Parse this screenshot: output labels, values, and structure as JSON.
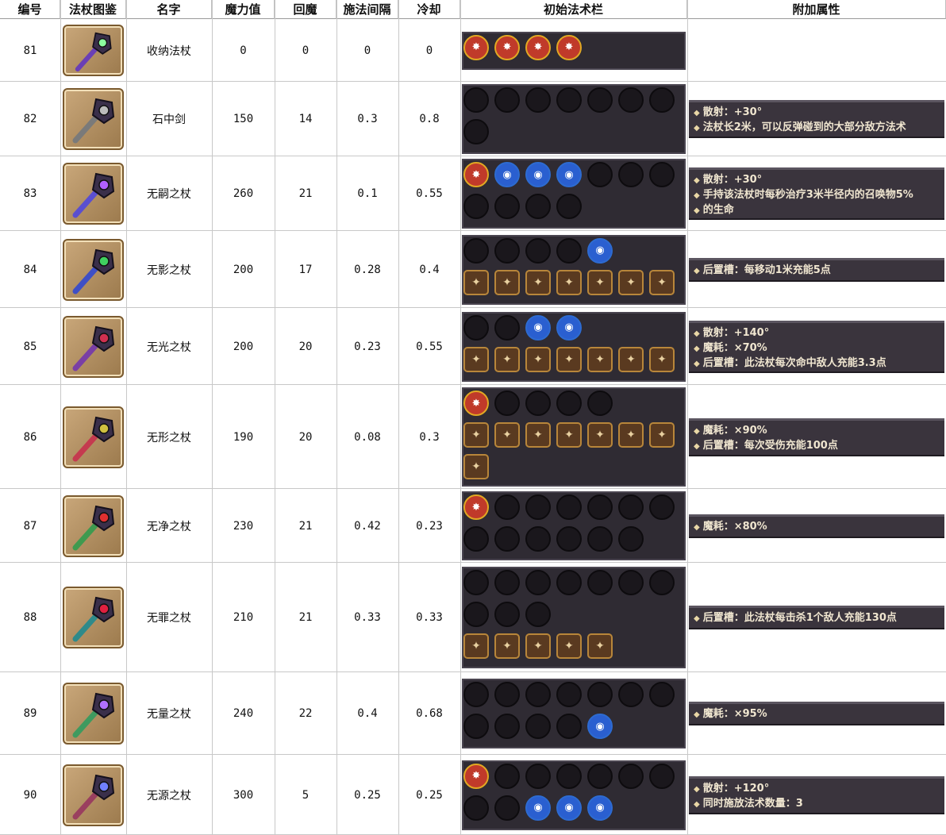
{
  "headers": {
    "id": "编号",
    "icon": "法杖图鉴",
    "name": "名字",
    "mana": "魔力值",
    "regen": "回魔",
    "interval": "施法间隔",
    "cooldown": "冷却",
    "spells": "初始法术栏",
    "attrs": "附加属性"
  },
  "rows": [
    {
      "id": "81",
      "name": "收纳法杖",
      "mana": "0",
      "regen": "0",
      "interval": "0",
      "cooldown": "0",
      "attrs": []
    },
    {
      "id": "82",
      "name": "石中剑",
      "mana": "150",
      "regen": "14",
      "interval": "0.3",
      "cooldown": "0.8",
      "attrs": [
        "散射：+30°",
        "法杖长2米，可以反弹碰到的大部分敌方法术"
      ]
    },
    {
      "id": "83",
      "name": "无嗣之杖",
      "mana": "260",
      "regen": "21",
      "interval": "0.1",
      "cooldown": "0.55",
      "attrs": [
        "散射：+30°",
        "手持该法杖时每秒治疗3米半径内的召唤物5%",
        "的生命"
      ]
    },
    {
      "id": "84",
      "name": "无影之杖",
      "mana": "200",
      "regen": "17",
      "interval": "0.28",
      "cooldown": "0.4",
      "attrs": [
        "后置槽：每移动1米充能5点"
      ]
    },
    {
      "id": "85",
      "name": "无光之杖",
      "mana": "200",
      "regen": "20",
      "interval": "0.23",
      "cooldown": "0.55",
      "attrs": [
        "散射：+140°",
        "魔耗：×70%",
        "后置槽：此法杖每次命中敌人充能3.3点"
      ]
    },
    {
      "id": "86",
      "name": "无形之杖",
      "mana": "190",
      "regen": "20",
      "interval": "0.08",
      "cooldown": "0.3",
      "attrs": [
        "魔耗：×90%",
        "后置槽：每次受伤充能100点"
      ]
    },
    {
      "id": "87",
      "name": "无净之杖",
      "mana": "230",
      "regen": "21",
      "interval": "0.42",
      "cooldown": "0.23",
      "attrs": [
        "魔耗：×80%"
      ]
    },
    {
      "id": "88",
      "name": "无罪之杖",
      "mana": "210",
      "regen": "21",
      "interval": "0.33",
      "cooldown": "0.33",
      "attrs": [
        "后置槽：此法杖每击杀1个敌人充能130点"
      ]
    },
    {
      "id": "89",
      "name": "无量之杖",
      "mana": "240",
      "regen": "22",
      "interval": "0.4",
      "cooldown": "0.68",
      "attrs": [
        "魔耗：×95%"
      ]
    },
    {
      "id": "90",
      "name": "无源之杖",
      "mana": "300",
      "regen": "5",
      "interval": "0.25",
      "cooldown": "0.25",
      "attrs": [
        "散射：+120°",
        "同时施放法术数量：3"
      ]
    }
  ]
}
